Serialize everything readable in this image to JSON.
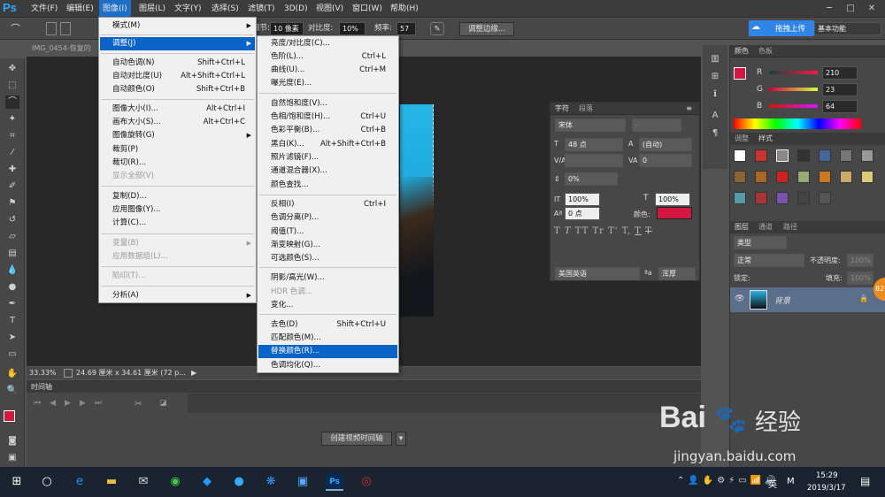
{
  "app": {
    "logo": "Ps"
  },
  "menubar": {
    "items": [
      "文件(F)",
      "编辑(E)",
      "图像(I)",
      "图层(L)",
      "文字(Y)",
      "选择(S)",
      "滤镜(T)",
      "3D(D)",
      "视图(V)",
      "窗口(W)",
      "帮助(H)"
    ]
  },
  "options": {
    "size_label": "细节:",
    "size_value": "10 像素",
    "contrast_label": "对比度:",
    "contrast_value": "10%",
    "freq_label": "频率:",
    "freq_value": "57",
    "refine_edge": "调整边缘...",
    "upload": "拖拽上传",
    "workspace": "基本功能"
  },
  "document": {
    "tab": "IMG_0454-恢复的",
    "zoom": "33.33%",
    "size_info": "24.69 厘米 x 34.61 厘米 (72 p..."
  },
  "timeline": {
    "title": "时间轴",
    "create_btn": "创建视频时间轴"
  },
  "image_menu": {
    "items": [
      {
        "label": "模式(M)",
        "sub": true
      },
      {
        "label": "调整(J)",
        "sub": true,
        "active": true
      },
      {
        "label": "自动色调(N)",
        "shortcut": "Shift+Ctrl+L"
      },
      {
        "label": "自动对比度(U)",
        "shortcut": "Alt+Shift+Ctrl+L"
      },
      {
        "label": "自动颜色(O)",
        "shortcut": "Shift+Ctrl+B"
      },
      {
        "label": "图像大小(I)...",
        "shortcut": "Alt+Ctrl+I"
      },
      {
        "label": "画布大小(S)...",
        "shortcut": "Alt+Ctrl+C"
      },
      {
        "label": "图像旋转(G)",
        "sub": true
      },
      {
        "label": "裁剪(P)"
      },
      {
        "label": "裁切(R)..."
      },
      {
        "label": "显示全部(V)",
        "disabled": true
      },
      {
        "label": "复制(D)..."
      },
      {
        "label": "应用图像(Y)..."
      },
      {
        "label": "计算(C)..."
      },
      {
        "label": "变量(B)",
        "sub": true,
        "disabled": true
      },
      {
        "label": "应用数据组(L)...",
        "disabled": true
      },
      {
        "label": "陷印(T)...",
        "disabled": true
      },
      {
        "label": "分析(A)",
        "sub": true
      }
    ]
  },
  "adjust_menu": {
    "items": [
      {
        "label": "亮度/对比度(C)..."
      },
      {
        "label": "色阶(L)...",
        "shortcut": "Ctrl+L"
      },
      {
        "label": "曲线(U)...",
        "shortcut": "Ctrl+M"
      },
      {
        "label": "曝光度(E)..."
      },
      {
        "label": "自然饱和度(V)..."
      },
      {
        "label": "色相/饱和度(H)...",
        "shortcut": "Ctrl+U"
      },
      {
        "label": "色彩平衡(B)...",
        "shortcut": "Ctrl+B"
      },
      {
        "label": "黑白(K)...",
        "shortcut": "Alt+Shift+Ctrl+B"
      },
      {
        "label": "照片滤镜(F)..."
      },
      {
        "label": "通道混合器(X)..."
      },
      {
        "label": "颜色查找..."
      },
      {
        "label": "反相(I)",
        "shortcut": "Ctrl+I"
      },
      {
        "label": "色调分离(P)..."
      },
      {
        "label": "阈值(T)..."
      },
      {
        "label": "渐变映射(G)..."
      },
      {
        "label": "可选颜色(S)..."
      },
      {
        "label": "阴影/高光(W)..."
      },
      {
        "label": "HDR 色调...",
        "disabled": true
      },
      {
        "label": "变化..."
      },
      {
        "label": "去色(D)",
        "shortcut": "Shift+Ctrl+U"
      },
      {
        "label": "匹配颜色(M)..."
      },
      {
        "label": "替换颜色(R)...",
        "highlighted": true
      },
      {
        "label": "色调均化(Q)..."
      }
    ]
  },
  "char_panel": {
    "tabs": [
      "字符",
      "段落"
    ],
    "font": "宋体",
    "style": "-",
    "size": "48 点",
    "leading": "(自动)",
    "kerning": "",
    "tracking": "0",
    "scale_pct": "0%",
    "vscale": "100%",
    "hscale": "100%",
    "baseline": "0 点",
    "color_label": "颜色:",
    "language": "美国英语",
    "aa": "浑厚",
    "aa_icon": "ªa",
    "type_buttons": [
      "T",
      "T",
      "TT",
      "Tr",
      "T'",
      "T,",
      "T",
      "T"
    ]
  },
  "color_panel": {
    "tabs": [
      "颜色",
      "色板"
    ],
    "r": "210",
    "g": "23",
    "b": "64",
    "r_label": "R",
    "g_label": "G",
    "b_label": "B",
    "fg_color": "#d21740"
  },
  "styles_panel": {
    "tabs": [
      "调整",
      "样式"
    ]
  },
  "layers_panel": {
    "tabs": [
      "图层",
      "通道",
      "路径"
    ],
    "filter": "类型",
    "blend": "正常",
    "opacity_label": "不透明度:",
    "opacity": "100%",
    "lock_label": "锁定:",
    "fill_label": "填充:",
    "fill": "100%",
    "layer_name": "背景"
  },
  "taskbar": {
    "time": "15:29",
    "date": "2019/3/17",
    "ime": "英",
    "ime2": "M"
  },
  "watermark": {
    "brand": "Bai",
    "brand2": "经验",
    "url": "jingyan.baidu.com"
  },
  "badge": "82"
}
